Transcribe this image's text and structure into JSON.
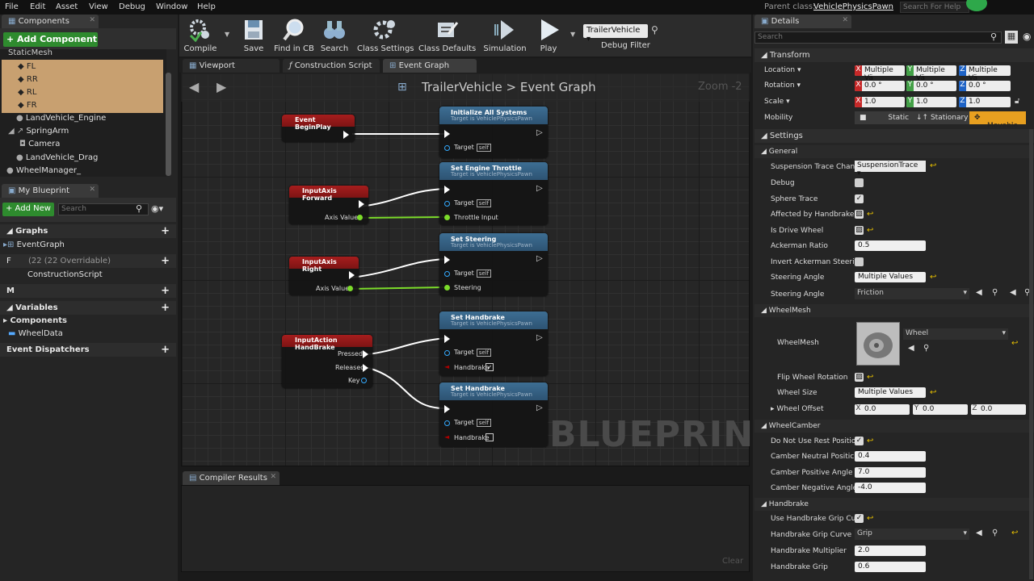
{
  "menu": [
    "File",
    "Edit",
    "Asset",
    "View",
    "Debug",
    "Window",
    "Help"
  ],
  "parent_class_label": "Parent class:",
  "parent_class_value": "VehiclePhysicsPawn",
  "help_search_placeholder": "Search For Help",
  "components_panel": {
    "tab": "Components",
    "add_button": "+ Add Component",
    "tree": [
      "StaticMesh",
      "FL",
      "RR",
      "RL",
      "FR",
      "LandVehicle_Engine",
      "SpringArm",
      "Camera",
      "LandVehicle_Drag",
      "WheelManager_"
    ]
  },
  "my_blueprint": {
    "tab": "My Blueprint",
    "add_new": "+ Add New",
    "search_placeholder": "Search",
    "graphs_label": "Graphs",
    "event_graph": "EventGraph",
    "functions_count": "(22 (22 Overridable)",
    "construction_script": "ConstructionScript",
    "variables_label": "Variables",
    "components_label": "Components",
    "wheel_data": "WheelData",
    "event_dispatchers": "Event Dispatchers"
  },
  "toolbar": {
    "compile": "Compile",
    "save": "Save",
    "find_in_cb": "Find in CB",
    "search": "Search",
    "class_settings": "Class Settings",
    "class_defaults": "Class Defaults",
    "simulation": "Simulation",
    "play": "Play",
    "debug_object": "TrailerVehicle",
    "debug_filter": "Debug Filter"
  },
  "editor_tabs": {
    "viewport": "Viewport",
    "construction_script": "Construction Script",
    "event_graph": "Event Graph"
  },
  "graph": {
    "breadcrumb_class": "TrailerVehicle",
    "breadcrumb_sep": ">",
    "breadcrumb_graph": "Event Graph",
    "zoom": "Zoom -2",
    "watermark": "BLUEPRINT",
    "target_label": "Target",
    "self_label": "self",
    "subtitle": "Target is VehiclePhysicsPawn",
    "events": {
      "begin_play": "Event BeginPlay",
      "axis_forward": "InputAxis Forward",
      "axis_right": "InputAxis Right",
      "action_handbrake": "InputAction HandBrake",
      "axis_value": "Axis Value",
      "pressed": "Pressed",
      "released": "Released",
      "key": "Key"
    },
    "functions": {
      "init": "Initialize All Systems",
      "throttle": "Set Engine Throttle",
      "throttle_pin": "Throttle Input",
      "steering": "Set Steering",
      "steering_pin": "Steering",
      "handbrake1": "Set Handbrake",
      "handbrake2": "Set Handbrake",
      "handbrake_pin": "Handbrake"
    }
  },
  "compiler": {
    "tab": "Compiler Results",
    "clear": "Clear"
  },
  "details": {
    "tab": "Details",
    "search_placeholder": "Search",
    "transform": "Transform",
    "location": "Location",
    "rotation": "Rotation",
    "scale": "Scale",
    "mobility": "Mobility",
    "multiple_values": "Multiple Vä",
    "rot_x": "0.0 °",
    "rot_y": "0.0 °",
    "rot_z": "0.0 °",
    "scale_x": "1.0",
    "scale_y": "1.0",
    "scale_z": "1.0",
    "static": "Static",
    "stationary": "Stationary",
    "movable": "Movable",
    "settings": "Settings",
    "general": "General",
    "suspension_trace": "Suspension Trace Chan",
    "suspension_trace_value": "SuspensionTrace",
    "debug": "Debug",
    "sphere_trace": "Sphere Trace",
    "affected_handbrake": "Affected by Handbrake",
    "is_drive_wheel": "Is Drive Wheel",
    "ackerman_ratio": "Ackerman Ratio",
    "ackerman_ratio_value": "0.5",
    "invert_ackerman": "Invert Ackerman Steerin",
    "steering_angle": "Steering Angle",
    "steering_angle_value": "Multiple Values",
    "steering_angle2": "Steering Angle",
    "friction": "Friction",
    "wheel_mesh_cat": "WheelMesh",
    "wheel_mesh": "WheelMesh",
    "wheel_mesh_value": "Wheel",
    "flip_wheel_rotation": "Flip Wheel Rotation",
    "wheel_size": "Wheel Size",
    "wheel_size_value": "Multiple Values",
    "wheel_offset": "Wheel Offset",
    "offset_x": "0.0",
    "offset_y": "0.0",
    "offset_z": "0.0",
    "wheel_camber": "WheelCamber",
    "no_rest_position": "Do Not Use Rest Positio",
    "camber_neutral": "Camber Neutral Positic",
    "camber_neutral_value": "0.4",
    "camber_positive": "Camber Positive Angle",
    "camber_positive_value": "7.0",
    "camber_negative": "Camber Negative Angle",
    "camber_negative_value": "-4.0",
    "handbrake": "Handbrake",
    "use_grip_curve": "Use Handbrake Grip Cur",
    "grip_curve": "Handbrake Grip Curve",
    "grip_curve_value": "Grip",
    "multiplier": "Handbrake Multiplier",
    "multiplier_value": "2.0",
    "grip": "Handbrake Grip",
    "grip_value": "0.6"
  },
  "colors": {
    "add_component_green": "#2e8b2e",
    "selection_tan": "#c8a070",
    "event_red": "#a61d1d",
    "func_blue": "#3d6e93",
    "movable_orange": "#e8a020",
    "reset_yellow": "#e8c000"
  }
}
